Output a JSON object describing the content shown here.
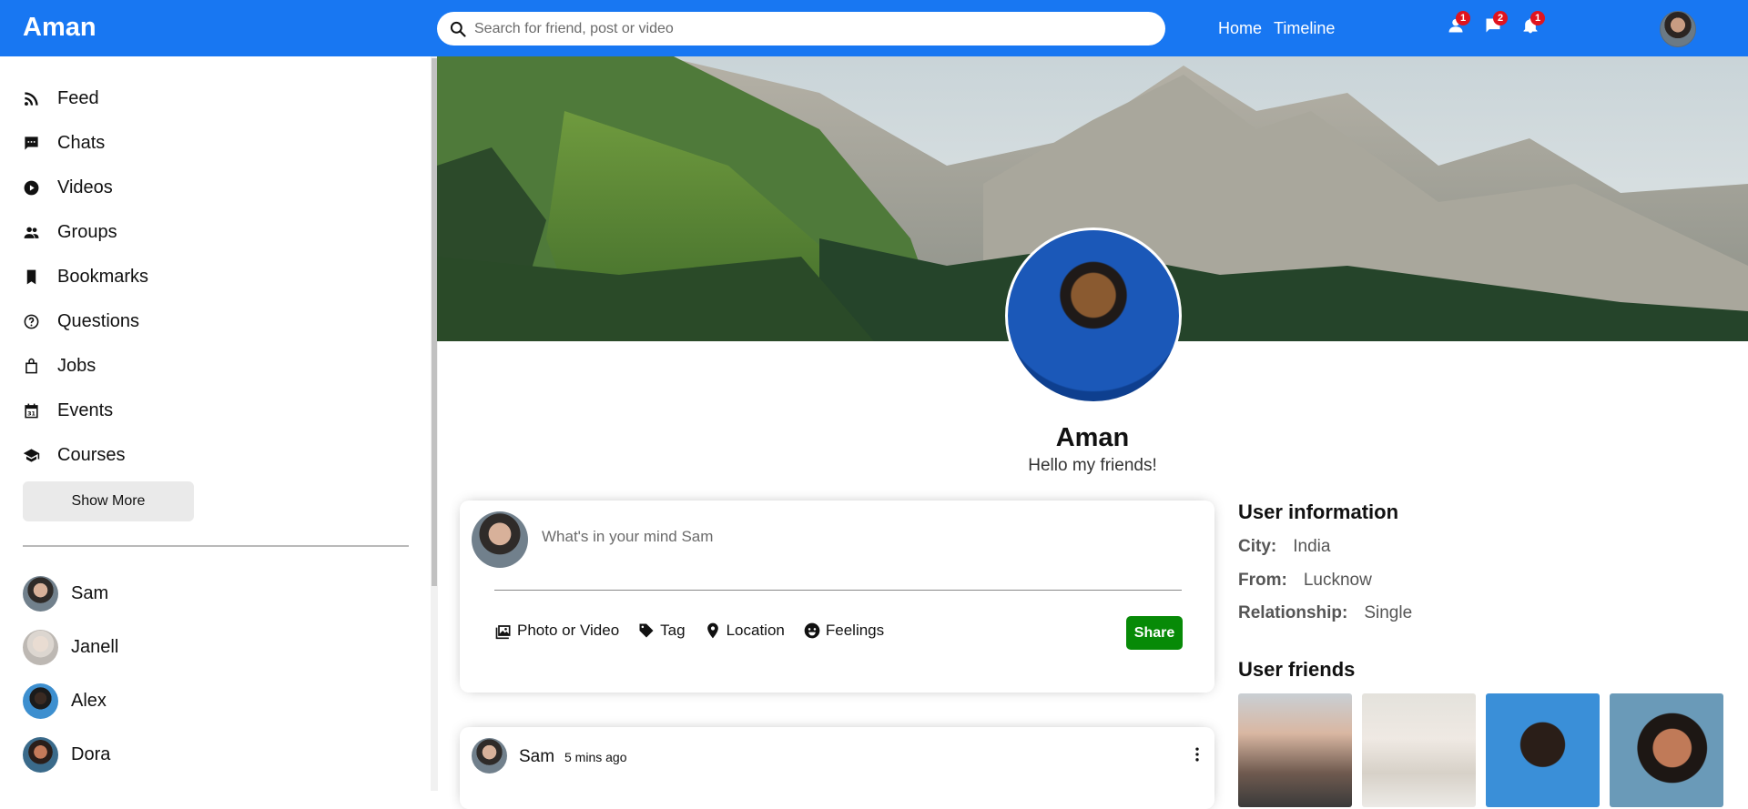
{
  "app": {
    "logo": "Aman"
  },
  "search": {
    "placeholder": "Search for friend, post or video"
  },
  "topbar": {
    "links": [
      "Home",
      "Timeline"
    ],
    "notifications": [
      {
        "icon": "person-icon",
        "count": "1"
      },
      {
        "icon": "chat-icon",
        "count": "2"
      },
      {
        "icon": "bell-icon",
        "count": "1"
      }
    ]
  },
  "sidebar": {
    "items": [
      {
        "label": "Feed",
        "icon": "rss-icon"
      },
      {
        "label": "Chats",
        "icon": "chat-icon"
      },
      {
        "label": "Videos",
        "icon": "play-icon"
      },
      {
        "label": "Groups",
        "icon": "group-icon"
      },
      {
        "label": "Bookmarks",
        "icon": "bookmark-icon"
      },
      {
        "label": "Questions",
        "icon": "question-icon"
      },
      {
        "label": "Jobs",
        "icon": "bag-icon"
      },
      {
        "label": "Events",
        "icon": "calendar-icon"
      },
      {
        "label": "Courses",
        "icon": "school-icon"
      }
    ],
    "show_more": "Show More",
    "friends": [
      "Sam",
      "Janell",
      "Alex",
      "Dora"
    ]
  },
  "profile": {
    "name": "Aman",
    "description": "Hello my friends!"
  },
  "share": {
    "placeholder": "What's in your mind Sam",
    "options": [
      "Photo or Video",
      "Tag",
      "Location",
      "Feelings"
    ],
    "button": "Share"
  },
  "post": {
    "user": "Sam",
    "time": "5 mins ago"
  },
  "user_info": {
    "title": "User information",
    "fields": [
      {
        "key": "City:",
        "value": "India"
      },
      {
        "key": "From:",
        "value": "Lucknow"
      },
      {
        "key": "Relationship:",
        "value": "Single"
      }
    ]
  },
  "user_friends": {
    "title": "User friends"
  },
  "colors": {
    "brand": "#1877f2",
    "share_button": "#078a07",
    "badge": "#e0141e"
  }
}
